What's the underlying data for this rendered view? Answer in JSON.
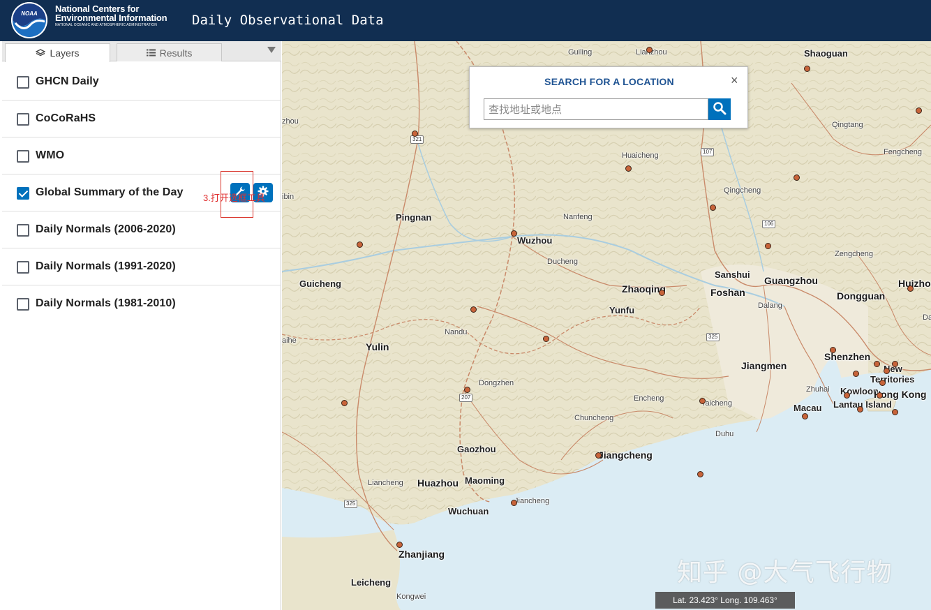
{
  "header": {
    "org_line1": "National Centers for",
    "org_line2": "Environmental Information",
    "org_line3": "NATIONAL OCEANIC AND ATMOSPHERIC ADMINISTRATION",
    "logo_text": "NOAA",
    "app_title": "Daily Observational Data",
    "bg_color": "#112e51"
  },
  "sidebar": {
    "tabs": [
      {
        "label": "Layers",
        "icon": "layers-icon",
        "active": true
      },
      {
        "label": "Results",
        "icon": "list-icon",
        "active": false
      }
    ],
    "layers": [
      {
        "label": "GHCN Daily",
        "checked": false
      },
      {
        "label": "CoCoRaHS",
        "checked": false
      },
      {
        "label": "WMO",
        "checked": false
      },
      {
        "label": "Global Summary of the Day",
        "checked": true
      },
      {
        "label": "Daily Normals (2006-2020)",
        "checked": false
      },
      {
        "label": "Daily Normals (1991-2020)",
        "checked": false
      },
      {
        "label": "Daily Normals (1981-2010)",
        "checked": false
      }
    ],
    "annotation": "3.打开选框工具",
    "accent_color": "#0071bc"
  },
  "search": {
    "title": "SEARCH FOR A LOCATION",
    "close": "×",
    "placeholder": "查找地址或地点",
    "value": ""
  },
  "map": {
    "cities": [
      {
        "name": "Guiling",
        "cls": "minor"
      },
      {
        "name": "Lianzhou",
        "cls": "minor"
      },
      {
        "name": "Shaoguan",
        "cls": "major"
      },
      {
        "name": "zhou",
        "cls": "minor"
      },
      {
        "name": "Qingtang",
        "cls": "minor"
      },
      {
        "name": "Huaicheng",
        "cls": "minor"
      },
      {
        "name": "Fengcheng",
        "cls": "minor"
      },
      {
        "name": "Qingcheng",
        "cls": "minor"
      },
      {
        "name": "ibin",
        "cls": "minor"
      },
      {
        "name": "Pingnan",
        "cls": "major"
      },
      {
        "name": "Nanfeng",
        "cls": "minor"
      },
      {
        "name": "Wuzhou",
        "cls": "major"
      },
      {
        "name": "Zengcheng",
        "cls": "minor"
      },
      {
        "name": "Ducheng",
        "cls": "minor"
      },
      {
        "name": "Sanshui",
        "cls": "major"
      },
      {
        "name": "Guangzhou",
        "cls": "big"
      },
      {
        "name": "Huizho",
        "cls": "big"
      },
      {
        "name": "Guicheng",
        "cls": "major"
      },
      {
        "name": "Zhaoqing",
        "cls": "big"
      },
      {
        "name": "Foshan",
        "cls": "big"
      },
      {
        "name": "Dongguan",
        "cls": "big"
      },
      {
        "name": "Dalang",
        "cls": "minor"
      },
      {
        "name": "Yunfu",
        "cls": "major"
      },
      {
        "name": "Da",
        "cls": "minor"
      },
      {
        "name": "Nandu",
        "cls": "minor"
      },
      {
        "name": "aihe",
        "cls": "minor"
      },
      {
        "name": "Yulin",
        "cls": "big"
      },
      {
        "name": "Shenzhen",
        "cls": "big"
      },
      {
        "name": "Jiangmen",
        "cls": "big"
      },
      {
        "name": "New",
        "cls": "major"
      },
      {
        "name": "Territories",
        "cls": "major"
      },
      {
        "name": "Dongzhen",
        "cls": "minor"
      },
      {
        "name": "Zhuhai",
        "cls": "minor"
      },
      {
        "name": "Kowloon",
        "cls": "major"
      },
      {
        "name": "Hong Kong",
        "cls": "big"
      },
      {
        "name": "Encheng",
        "cls": "minor"
      },
      {
        "name": "Taicheng",
        "cls": "minor"
      },
      {
        "name": "Macau",
        "cls": "major"
      },
      {
        "name": "Lantau Island",
        "cls": "major"
      },
      {
        "name": "Chuncheng",
        "cls": "minor"
      },
      {
        "name": "Duhu",
        "cls": "minor"
      },
      {
        "name": "Gaozhou",
        "cls": "major"
      },
      {
        "name": "Jiangcheng",
        "cls": "big"
      },
      {
        "name": "Liancheng",
        "cls": "minor"
      },
      {
        "name": "Huazhou",
        "cls": "big"
      },
      {
        "name": "Maoming",
        "cls": "major"
      },
      {
        "name": "Jiancheng",
        "cls": "minor"
      },
      {
        "name": "Wuchuan",
        "cls": "major"
      },
      {
        "name": "Zhanjiang",
        "cls": "big"
      },
      {
        "name": "Leicheng",
        "cls": "major"
      },
      {
        "name": "Kongwei",
        "cls": "minor"
      }
    ],
    "shields": [
      "321",
      "107",
      "106",
      "325",
      "207",
      "325"
    ],
    "coordinates": "Lat. 23.423° Long. 109.463°",
    "watermark": "知乎 @大气飞行物",
    "station_color": "#c8643a",
    "sea_color": "#dbecf4",
    "land_color": "#eae6cf"
  }
}
